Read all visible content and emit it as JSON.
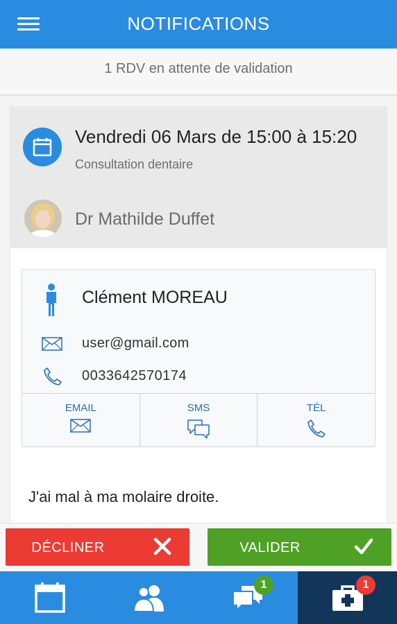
{
  "header": {
    "title": "NOTIFICATIONS",
    "menu_icon": "hamburger-menu-icon"
  },
  "subheader": {
    "pending_text": "1 RDV en attente de validation"
  },
  "appointment": {
    "date_text": "Vendredi 06 Mars de 15:00 à 15:20",
    "type": "Consultation dentaire",
    "doctor": "Dr Mathilde Duffet"
  },
  "patient": {
    "name": "Clément MOREAU",
    "email": "user@gmail.com",
    "phone": "0033642570174"
  },
  "contact_actions": [
    {
      "label": "EMAIL",
      "icon": "mail-icon"
    },
    {
      "label": "SMS",
      "icon": "chat-bubbles-icon"
    },
    {
      "label": "TÉL",
      "icon": "phone-icon"
    }
  ],
  "message": "J'ai mal à ma molaire droite.",
  "actions": {
    "decline_label": "DÉCLINER",
    "accept_label": "VALIDER"
  },
  "nav": {
    "tabs": [
      {
        "icon": "calendar-icon",
        "badge": null
      },
      {
        "icon": "users-icon",
        "badge": null
      },
      {
        "icon": "chat-icon",
        "badge": "1"
      },
      {
        "icon": "medical-kit-icon",
        "badge": "1"
      }
    ]
  },
  "colors": {
    "primary": "#2a8ce0",
    "decline": "#ec3b33",
    "accept": "#4fa126",
    "active_tab": "#12355a"
  }
}
